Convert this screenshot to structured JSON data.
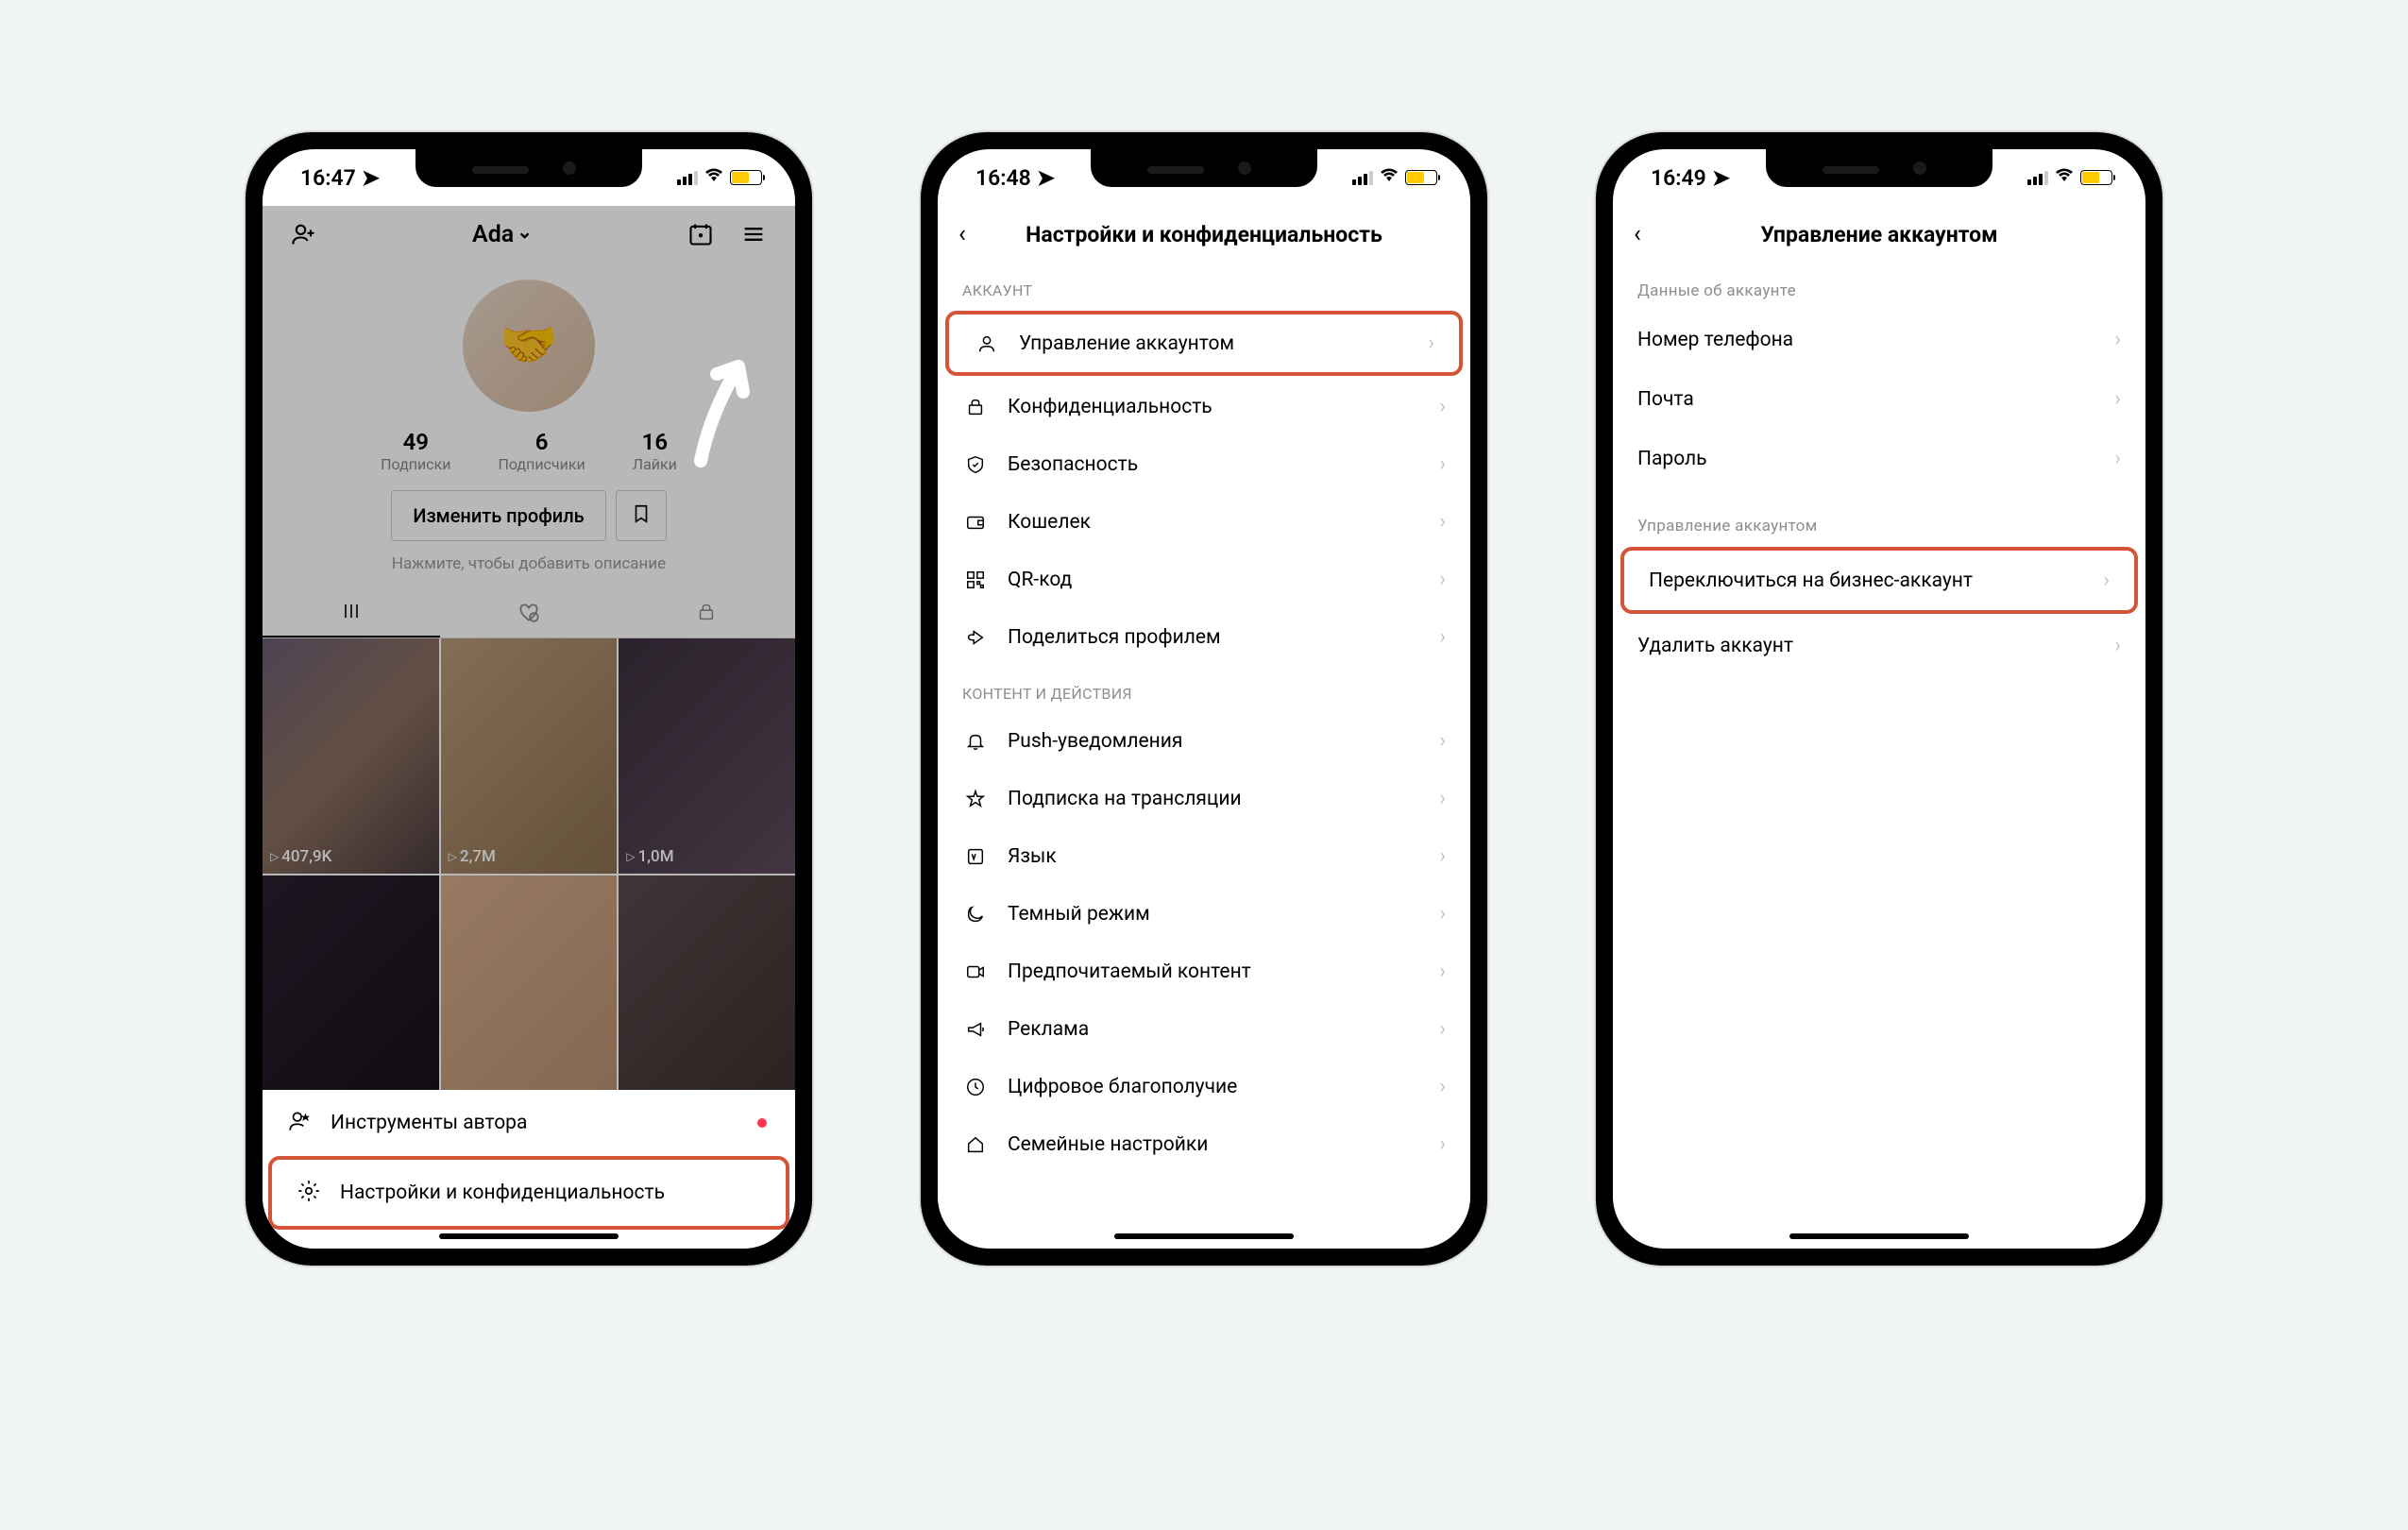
{
  "phone1": {
    "time": "16:47",
    "username": "Ada",
    "stats": [
      {
        "num": "49",
        "label": "Подписки"
      },
      {
        "num": "6",
        "label": "Подписчики"
      },
      {
        "num": "16",
        "label": "Лайки"
      }
    ],
    "edit_btn": "Изменить профиль",
    "bio": "Нажмите, чтобы добавить описание",
    "thumbs": [
      "407,9K",
      "2,7M",
      "1,0M",
      "",
      "",
      ""
    ],
    "sheet": [
      {
        "label": "Инструменты автора",
        "dot": true,
        "icon": "user-star"
      },
      {
        "label": "Настройки и конфиденциальность",
        "dot": false,
        "icon": "gear",
        "highlight": true
      }
    ]
  },
  "phone2": {
    "time": "16:48",
    "title": "Настройки и конфиденциальность",
    "sec1": "АККАУНТ",
    "sec2": "КОНТЕНТ И ДЕЙСТВИЯ",
    "rows1": [
      {
        "icon": "person",
        "label": "Управление аккаунтом",
        "highlight": true
      },
      {
        "icon": "lock",
        "label": "Конфиденциальность"
      },
      {
        "icon": "shield",
        "label": "Безопасность"
      },
      {
        "icon": "wallet",
        "label": "Кошелек"
      },
      {
        "icon": "qr",
        "label": "QR-код"
      },
      {
        "icon": "share",
        "label": "Поделиться профилем"
      }
    ],
    "rows2": [
      {
        "icon": "bell",
        "label": "Push-уведомления"
      },
      {
        "icon": "star",
        "label": "Подписка на трансляции"
      },
      {
        "icon": "lang",
        "label": "Язык"
      },
      {
        "icon": "moon",
        "label": "Темный режим"
      },
      {
        "icon": "video",
        "label": "Предпочитаемый контент"
      },
      {
        "icon": "mega",
        "label": "Реклама"
      },
      {
        "icon": "clock",
        "label": "Цифровое благополучие"
      },
      {
        "icon": "home",
        "label": "Семейные настройки"
      }
    ]
  },
  "phone3": {
    "time": "16:49",
    "title": "Управление аккаунтом",
    "sec1": "Данные об аккаунте",
    "sec2": "Управление аккаунтом",
    "rows1": [
      {
        "label": "Номер телефона"
      },
      {
        "label": "Почта"
      },
      {
        "label": "Пароль"
      }
    ],
    "rows2": [
      {
        "label": "Переключиться на бизнес-аккаунт",
        "highlight": true
      },
      {
        "label": "Удалить аккаунт"
      }
    ]
  }
}
